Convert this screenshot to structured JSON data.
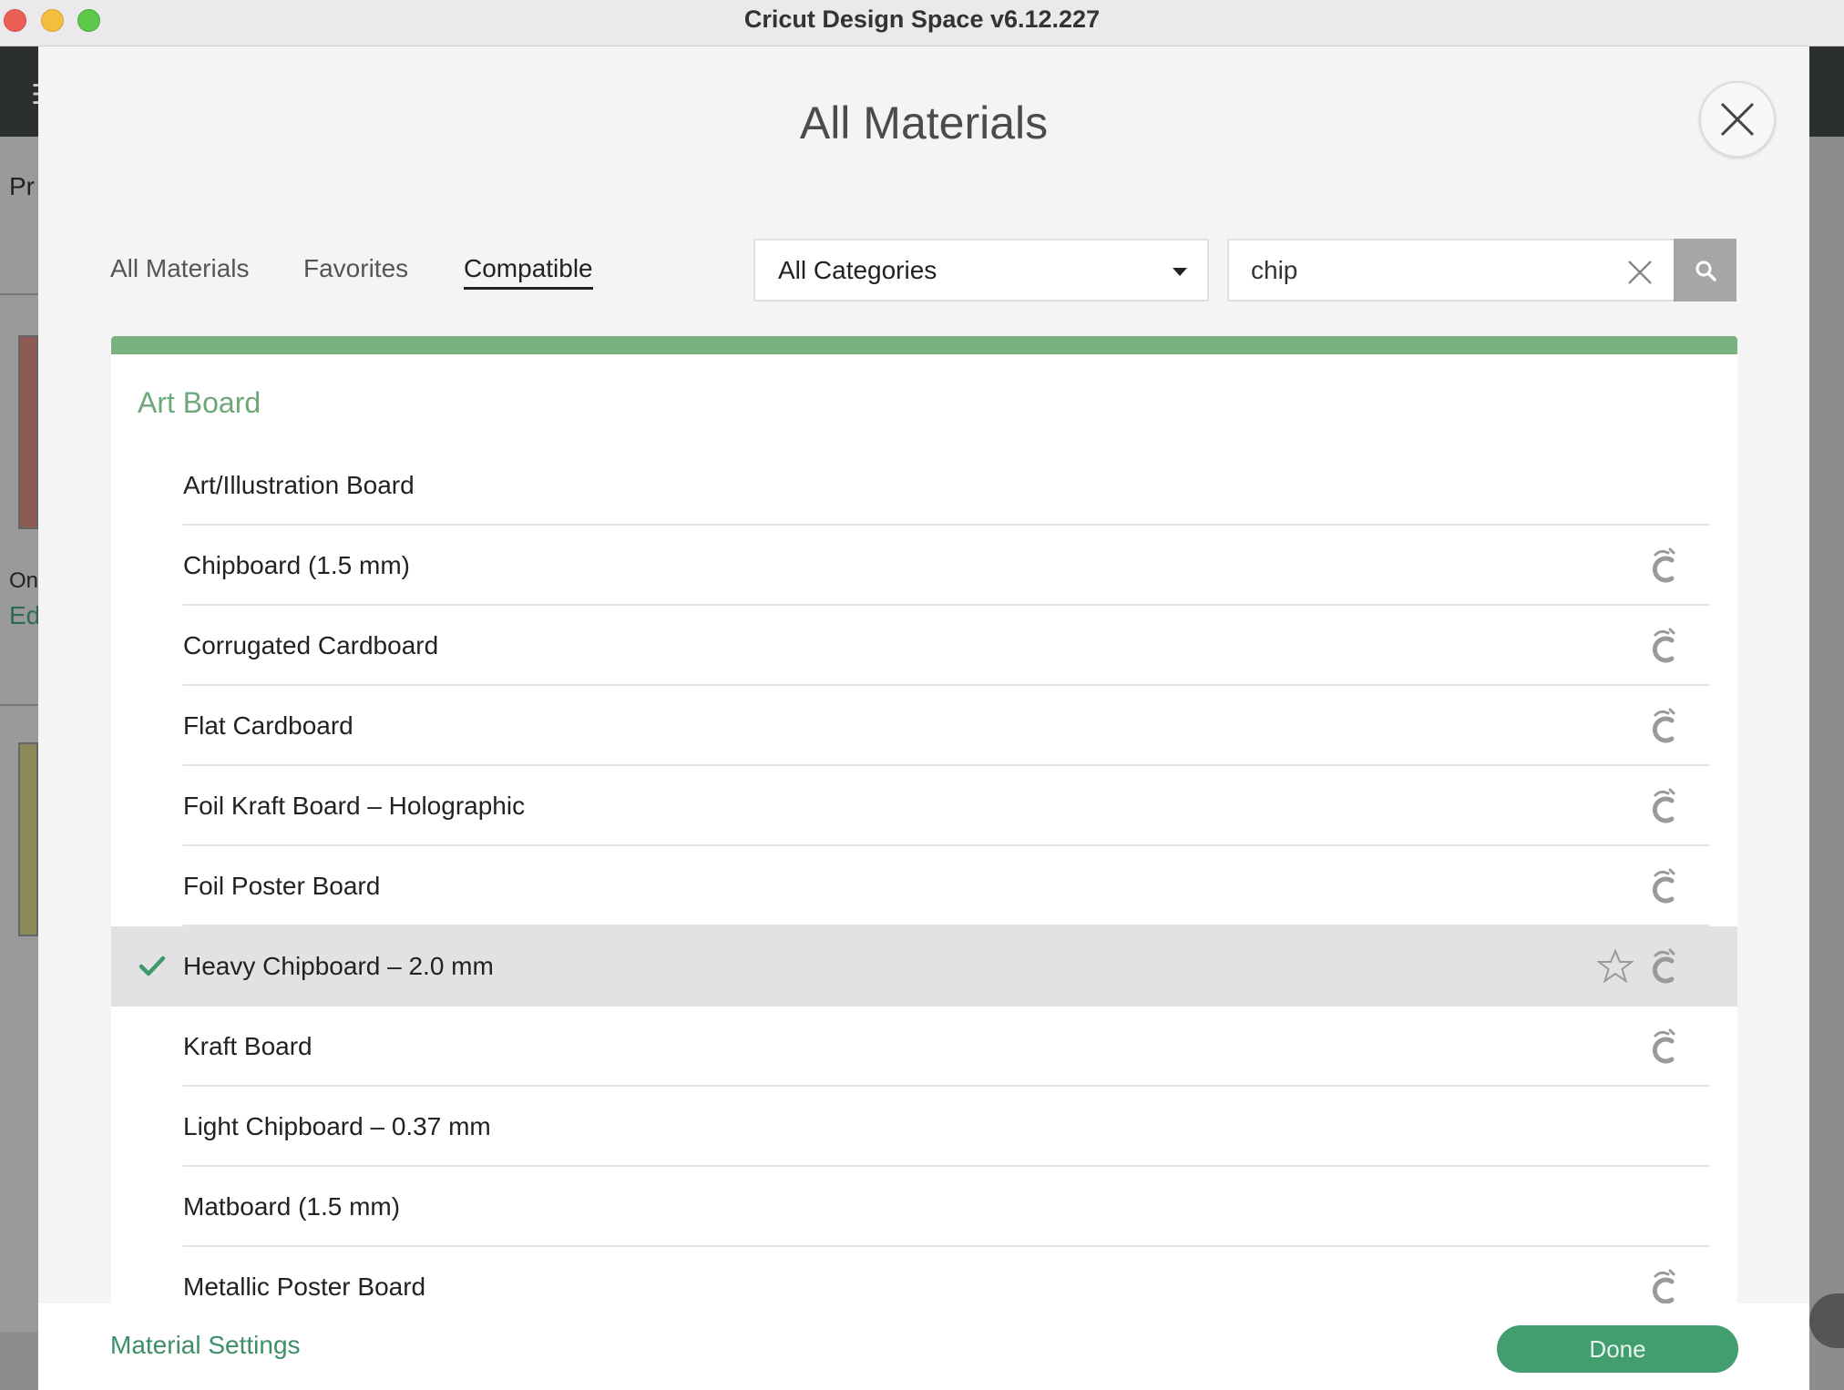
{
  "window": {
    "title": "Cricut Design Space  v6.12.227"
  },
  "background": {
    "text_pr": "Pr",
    "text_on": "On",
    "text_ed": "Ed"
  },
  "modal": {
    "title": "All Materials",
    "tabs": [
      {
        "label": "All Materials",
        "active": false
      },
      {
        "label": "Favorites",
        "active": false
      },
      {
        "label": "Compatible",
        "active": true
      }
    ],
    "category_select": {
      "value": "All Categories"
    },
    "search": {
      "value": "chip"
    },
    "group": {
      "name": "Art Board"
    },
    "items": [
      {
        "label": "Art/Illustration Board",
        "has_cricut_icon": false,
        "selected": false
      },
      {
        "label": "Chipboard (1.5 mm)",
        "has_cricut_icon": true,
        "selected": false
      },
      {
        "label": "Corrugated Cardboard",
        "has_cricut_icon": true,
        "selected": false
      },
      {
        "label": "Flat Cardboard",
        "has_cricut_icon": true,
        "selected": false
      },
      {
        "label": "Foil Kraft Board  – Holographic",
        "has_cricut_icon": true,
        "selected": false
      },
      {
        "label": "Foil Poster Board",
        "has_cricut_icon": true,
        "selected": false
      },
      {
        "label": "Heavy Chipboard – 2.0 mm",
        "has_cricut_icon": true,
        "selected": true
      },
      {
        "label": "Kraft Board",
        "has_cricut_icon": true,
        "selected": false
      },
      {
        "label": "Light Chipboard – 0.37 mm",
        "has_cricut_icon": false,
        "selected": false
      },
      {
        "label": "Matboard (1.5 mm)",
        "has_cricut_icon": false,
        "selected": false
      },
      {
        "label": "Metallic Poster Board",
        "has_cricut_icon": true,
        "selected": false
      }
    ],
    "footer": {
      "material_settings": "Material Settings",
      "done": "Done"
    }
  },
  "colors": {
    "accent_green": "#429e6e",
    "group_header_green": "#6fa878",
    "top_bar_green": "#7ab27f",
    "selected_row": "#e2e2e4"
  }
}
